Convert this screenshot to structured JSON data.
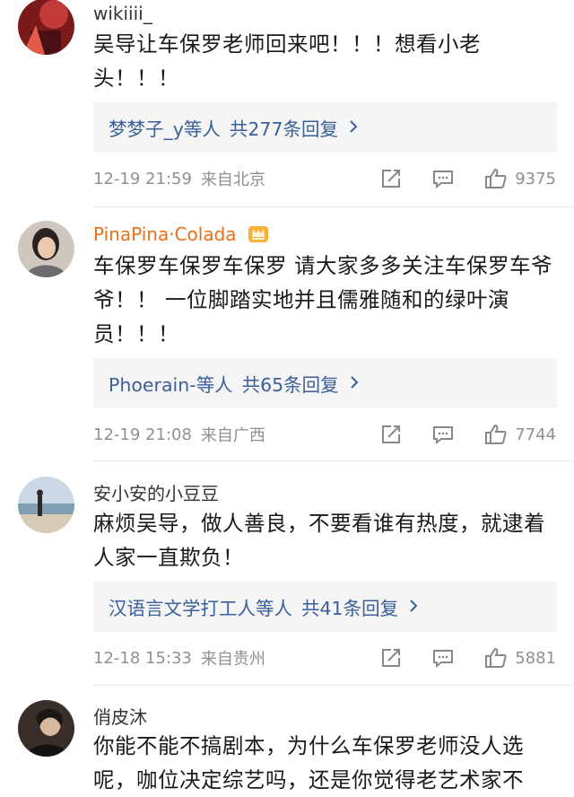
{
  "comments": [
    {
      "username": "wikiiii_",
      "text": "吴导让车保罗老师回来吧！！！想看小老头！！！",
      "reply": {
        "users": "梦梦子_y等人",
        "total": "共277条回复"
      },
      "time": "12-19 21:59",
      "location": "来自北京",
      "likes": "9375"
    },
    {
      "username": "PinaPina·Colada",
      "text": "车保罗车保罗车保罗 请大家多多关注车保罗车爷爷！！ 一位脚踏实地并且儒雅随和的绿叶演员！！！",
      "reply": {
        "users": "Phoerain-等人",
        "total": "共65条回复"
      },
      "time": "12-19 21:08",
      "location": "来自广西",
      "likes": "7744"
    },
    {
      "username": "安小安的小豆豆",
      "text": "麻烦吴导，做人善良，不要看谁有热度，就逮着人家一直欺负！",
      "reply": {
        "users": "汉语言文学打工人等人",
        "total": "共41条回复"
      },
      "time": "12-18 15:33",
      "location": "来自贵州",
      "likes": "5881"
    },
    {
      "username": "俏皮沐",
      "text": "你能不能不搞剧本，为什么车保罗老师没人选呢，咖位决定综艺吗，还是你觉得老艺术家不"
    }
  ],
  "icons": {
    "share": "share-icon",
    "comment": "comment-icon",
    "like": "thumbs-up-icon",
    "chevron": "chevron-right-icon",
    "crown": "vip-crown-icon"
  },
  "colors": {
    "link": "#3a5f9a",
    "vip_name": "#e8701a",
    "meta": "#909090",
    "reply_bg": "#f5f5f5"
  }
}
